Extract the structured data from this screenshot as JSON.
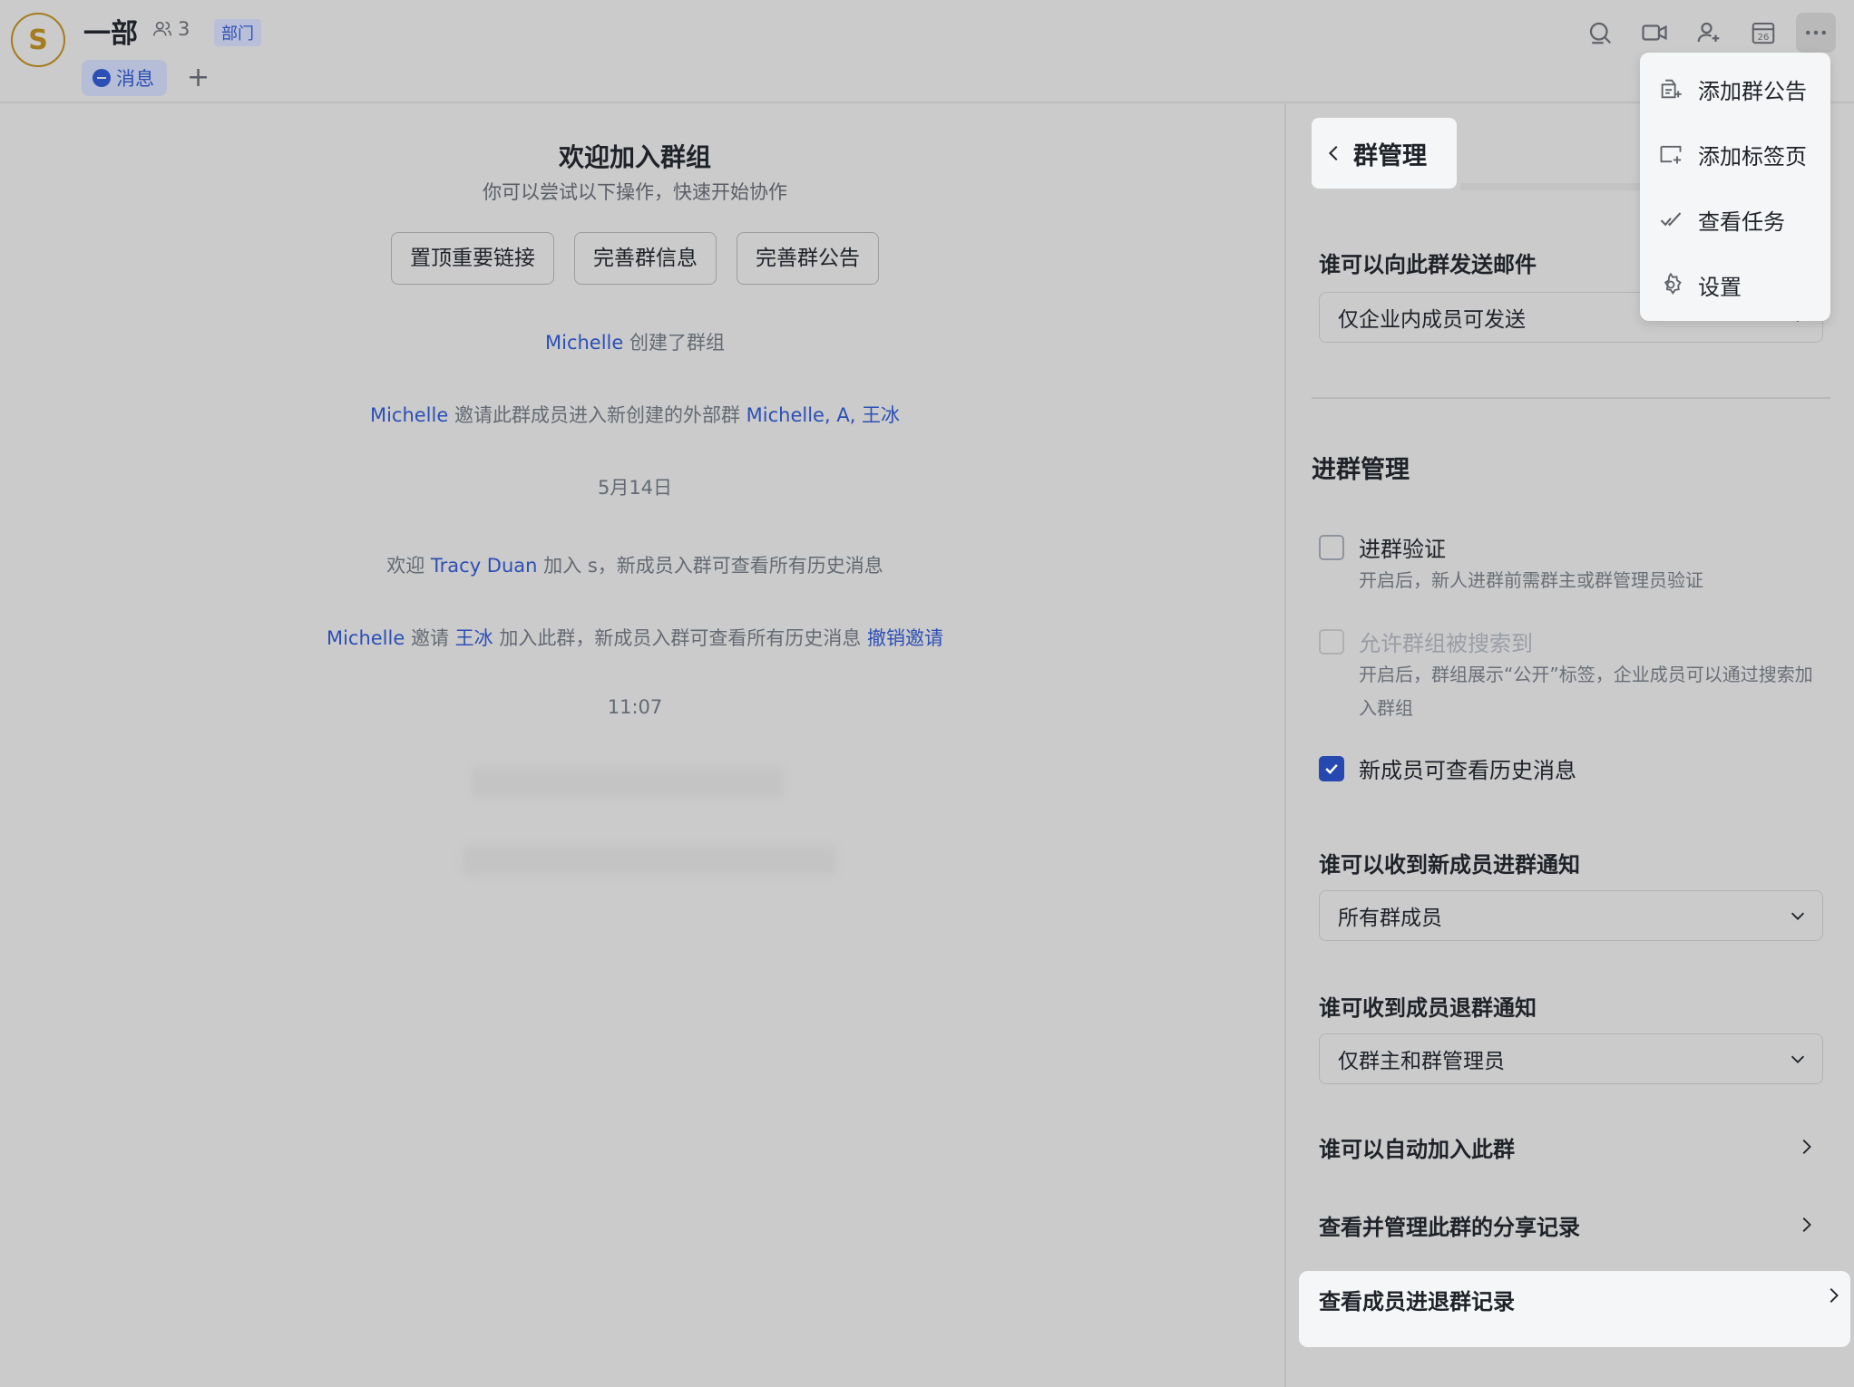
{
  "header": {
    "avatar_letter": "S",
    "group_name": "一部",
    "member_count": "3",
    "dept_badge": "部门",
    "tab_message": "消息",
    "tab_add": "+",
    "icons": [
      "search-icon",
      "video-icon",
      "add-member-icon",
      "calendar-icon",
      "more-icon"
    ],
    "calendar_day": "26"
  },
  "chat": {
    "welcome_title": "欢迎加入群组",
    "welcome_subtitle": "你可以尝试以下操作，快速开始协作",
    "actions": [
      "置顶重要链接",
      "完善群信息",
      "完善群公告"
    ],
    "messages": [
      {
        "user": "Michelle",
        "text": "创建了群组"
      },
      {
        "user": "Michelle",
        "text": "邀请此群成员进入新创建的外部群",
        "target": "Michelle, A, 王冰"
      },
      {
        "date": "5月14日"
      },
      {
        "prefix": "欢迎",
        "user": "Tracy Duan",
        "text": "加入 s，新成员入群可查看所有历史消息"
      },
      {
        "user": "Michelle",
        "mid": "邀请",
        "user2": "王冰",
        "text": "加入此群，新成员入群可查看所有历史消息",
        "link": "撤销邀请"
      },
      {
        "time": "11:07"
      }
    ]
  },
  "panel": {
    "title": "群管理",
    "email_label": "谁可以向此群发送邮件",
    "email_value": "仅企业内成员可发送",
    "join_section": "进群管理",
    "verify_label": "进群验证",
    "verify_desc": "开启后，新人进群前需群主或群管理员验证",
    "searchable_label": "允许群组被搜索到",
    "searchable_desc": "开启后，群组展示“公开”标签，企业成员可以通过搜索加入群组",
    "history_label": "新成员可查看历史消息",
    "history_checked": true,
    "join_notice_label": "谁可以收到新成员进群通知",
    "join_notice_value": "所有群成员",
    "leave_notice_label": "谁可收到成员退群通知",
    "leave_notice_value": "仅群主和群管理员",
    "nav_auto_join": "谁可以自动加入此群",
    "nav_share_records": "查看并管理此群的分享记录",
    "nav_member_records": "查看成员进退群记录"
  },
  "menu": {
    "items": [
      {
        "label": "添加群公告",
        "icon": "announcement-add-icon"
      },
      {
        "label": "添加标签页",
        "icon": "tab-add-icon"
      },
      {
        "label": "查看任务",
        "icon": "task-icon"
      },
      {
        "label": "设置",
        "icon": "settings-icon"
      }
    ]
  },
  "colors": {
    "background": "#cbcbcb",
    "accent": "#2648b0",
    "link": "#2c4fb6",
    "avatar": "#a57c1e",
    "highlight_surface": "#f5f6f7"
  }
}
